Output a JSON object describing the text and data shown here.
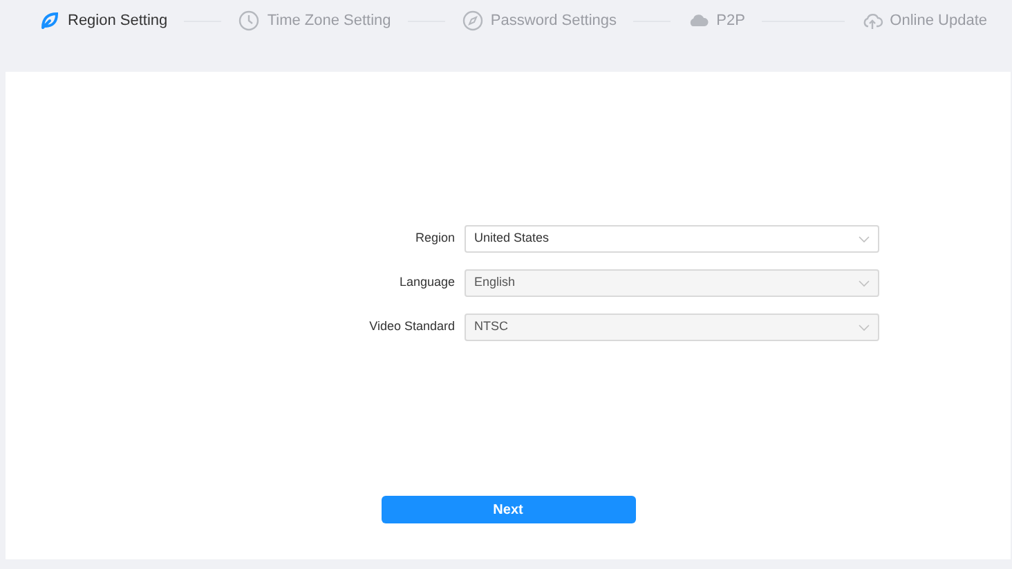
{
  "steps": [
    {
      "kind": "leaf",
      "label": "Region Setting",
      "selected": true
    },
    {
      "kind": "clock",
      "label": "Time Zone Setting",
      "selected": false
    },
    {
      "kind": "compass",
      "label": "Password Settings",
      "selected": false
    },
    {
      "kind": "cloud",
      "label": "P2P",
      "selected": false
    },
    {
      "kind": "upload",
      "label": "Online Update",
      "selected": false
    }
  ],
  "form": [
    {
      "label": "Region",
      "value": "United States",
      "disabled": false
    },
    {
      "label": "Language",
      "value": "English",
      "disabled": true
    },
    {
      "label": "Video Standard",
      "value": "NTSC",
      "disabled": true
    }
  ],
  "next_button": "Next"
}
